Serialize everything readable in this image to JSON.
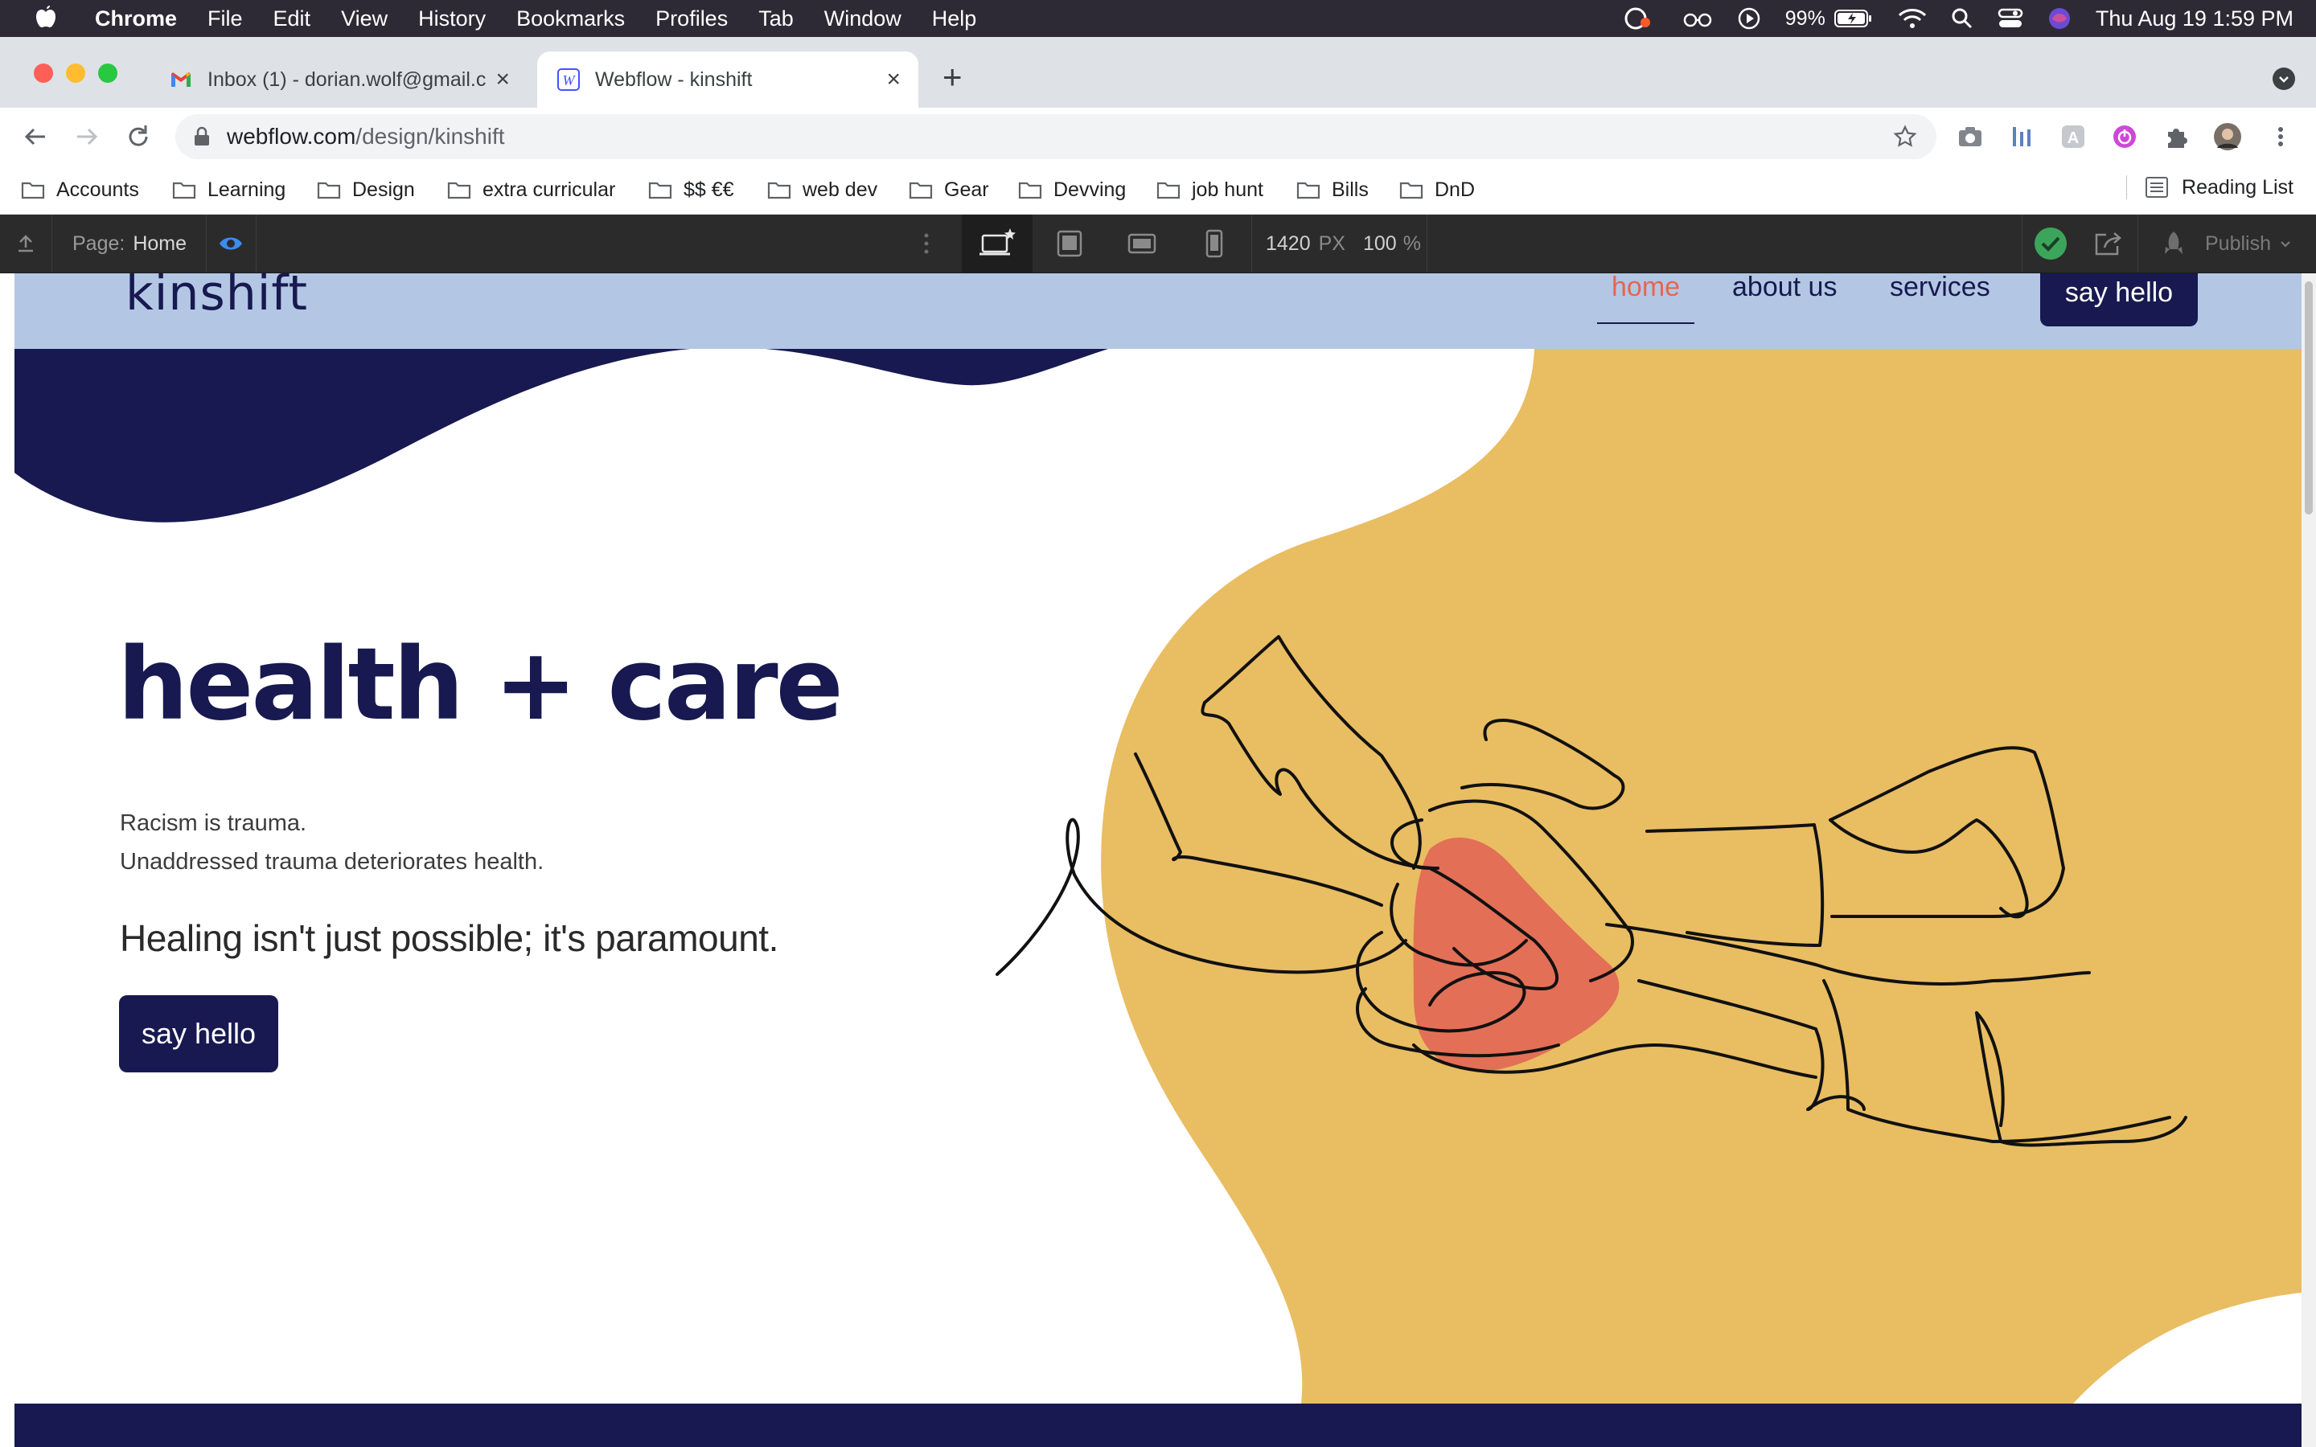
{
  "menubar": {
    "app_name": "Chrome",
    "items": [
      "File",
      "Edit",
      "View",
      "History",
      "Bookmarks",
      "Profiles",
      "Tab",
      "Window",
      "Help"
    ],
    "battery": "99%",
    "datetime": "Thu Aug 19  1:59 PM"
  },
  "tabs": [
    {
      "title": "Inbox (1) - dorian.wolf@gmail.c",
      "icon": "gmail-icon",
      "active": false
    },
    {
      "title": "Webflow - kinshift",
      "icon": "webflow-icon",
      "active": true
    }
  ],
  "address_bar": {
    "domain": "webflow.com",
    "path": "/design/kinshift"
  },
  "bookmarks": [
    "Accounts",
    "Learning",
    "Design",
    "extra curricular",
    "$$ €€",
    "web dev",
    "Gear",
    "Devving",
    "job hunt",
    "Bills",
    "DnD"
  ],
  "reading_list": "Reading List",
  "webflow": {
    "page_label": "Page:",
    "page_name": "Home",
    "canvas_width": "1420",
    "width_unit": "PX",
    "zoom": "100",
    "zoom_unit": "%",
    "publish_label": "Publish"
  },
  "site": {
    "logo": "kinshift",
    "nav": [
      "home",
      "about us",
      "services"
    ],
    "nav_cta": "say hello",
    "hero_title": "health + care",
    "hero_lines": [
      "Racism is trauma.",
      "Unaddressed trauma deteriorates health."
    ],
    "hero_lead": "Healing isn't just possible; it's paramount.",
    "hero_cta": "say hello"
  },
  "colors": {
    "navy": "#171950",
    "gold": "#e9bd62",
    "coral": "#e8654f",
    "nav_bg": "#b3c7e4"
  }
}
